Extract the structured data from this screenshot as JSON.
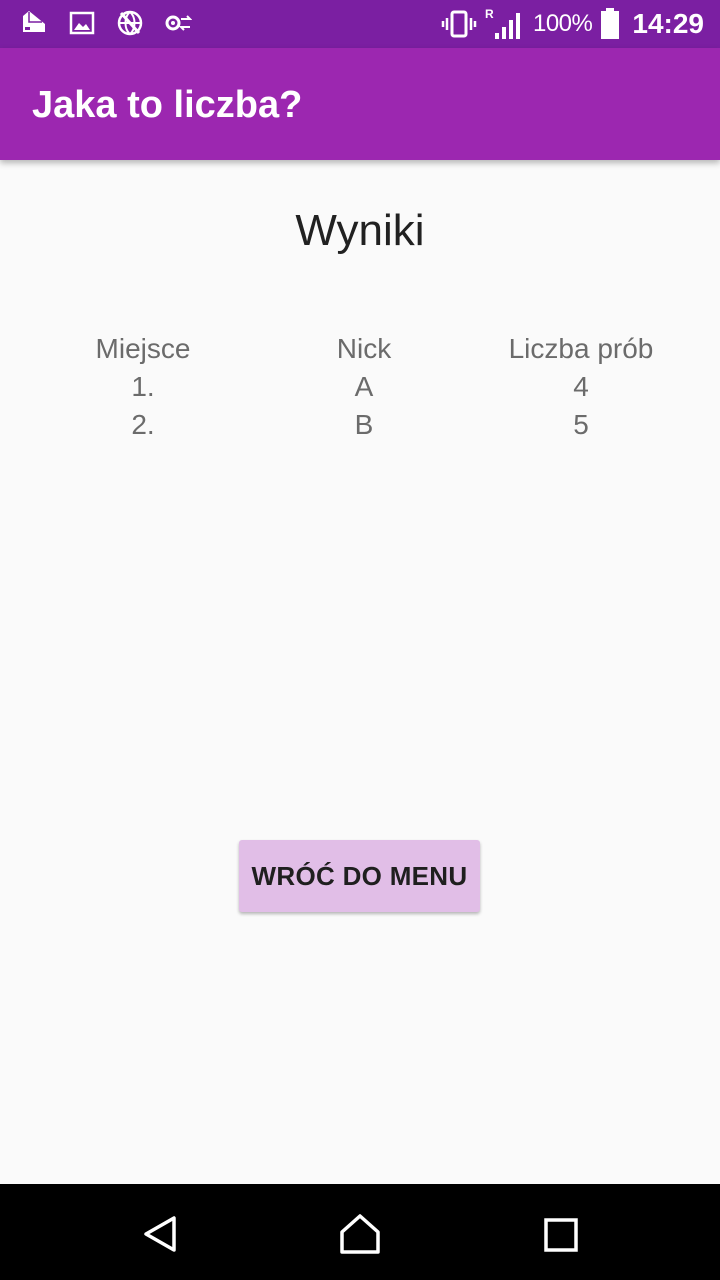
{
  "status_bar": {
    "left_icons": [
      "wallet-notification-icon",
      "image-icon",
      "vpn-globe-icon",
      "settings-sync-icon"
    ],
    "vibrate_icon": "vibrate-icon",
    "roaming_indicator": "R",
    "signal_icon": "signal-icon",
    "battery_percent": "100%",
    "battery_icon": "battery-icon",
    "time": "14:29",
    "color": "#7b1fa2"
  },
  "app_bar": {
    "title": "Jaka to liczba?",
    "color": "#9c27b0"
  },
  "results_screen": {
    "title": "Wyniki",
    "columns": [
      "Miejsce",
      "Nick",
      "Liczba prób"
    ],
    "rows": [
      [
        "1.",
        "A",
        "4"
      ],
      [
        "2.",
        "B",
        "5"
      ]
    ]
  },
  "actions": {
    "back_to_menu_label": "WRÓĆ DO MENU",
    "button_color": "#e1bee7"
  },
  "nav_bar": {
    "back_icon": "back-triangle-icon",
    "home_icon": "home-icon",
    "recents_icon": "recents-square-icon"
  }
}
